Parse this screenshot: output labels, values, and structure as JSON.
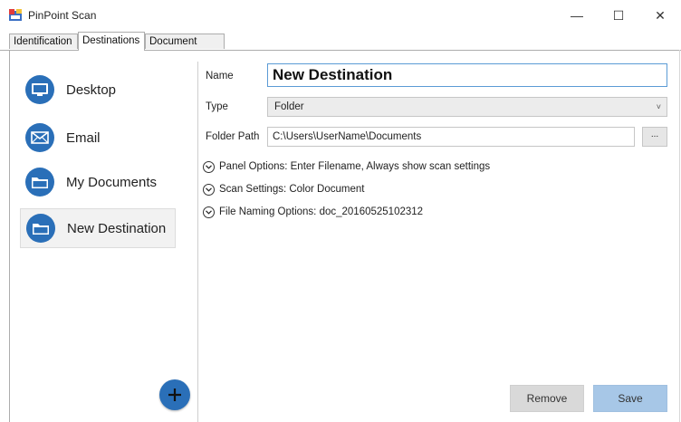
{
  "window": {
    "title": "PinPoint Scan",
    "min_glyph": "—",
    "max_glyph": "☐",
    "close_glyph": "✕"
  },
  "tabs": [
    {
      "label": "Identification",
      "active": false
    },
    {
      "label": "Destinations",
      "active": true
    },
    {
      "label": "Document Logs",
      "active": false
    }
  ],
  "sidebar": {
    "items": [
      {
        "label": "Desktop",
        "icon": "monitor-icon",
        "selected": false
      },
      {
        "label": "Email",
        "icon": "envelope-icon",
        "selected": false
      },
      {
        "label": "My Documents",
        "icon": "folder-icon",
        "selected": false
      },
      {
        "label": "New Destination",
        "icon": "folder-icon",
        "selected": true
      }
    ],
    "add_glyph": "+"
  },
  "form": {
    "name_label": "Name",
    "name_value": "New Destination",
    "type_label": "Type",
    "type_value": "Folder",
    "folder_path_label": "Folder Path",
    "folder_path_value": "C:\\Users\\UserName\\Documents",
    "browse_label": "...",
    "expanders": [
      {
        "label": "Panel Options: Enter Filename, Always show scan settings"
      },
      {
        "label": "Scan Settings: Color Document"
      },
      {
        "label": "File Naming Options: doc_20160525102312"
      }
    ]
  },
  "buttons": {
    "remove": "Remove",
    "save": "Save"
  },
  "colors": {
    "accent": "#2a6fb8",
    "save_button": "#a7c7e7",
    "remove_button": "#d9d9d9",
    "focus_border": "#5b9bd5"
  }
}
